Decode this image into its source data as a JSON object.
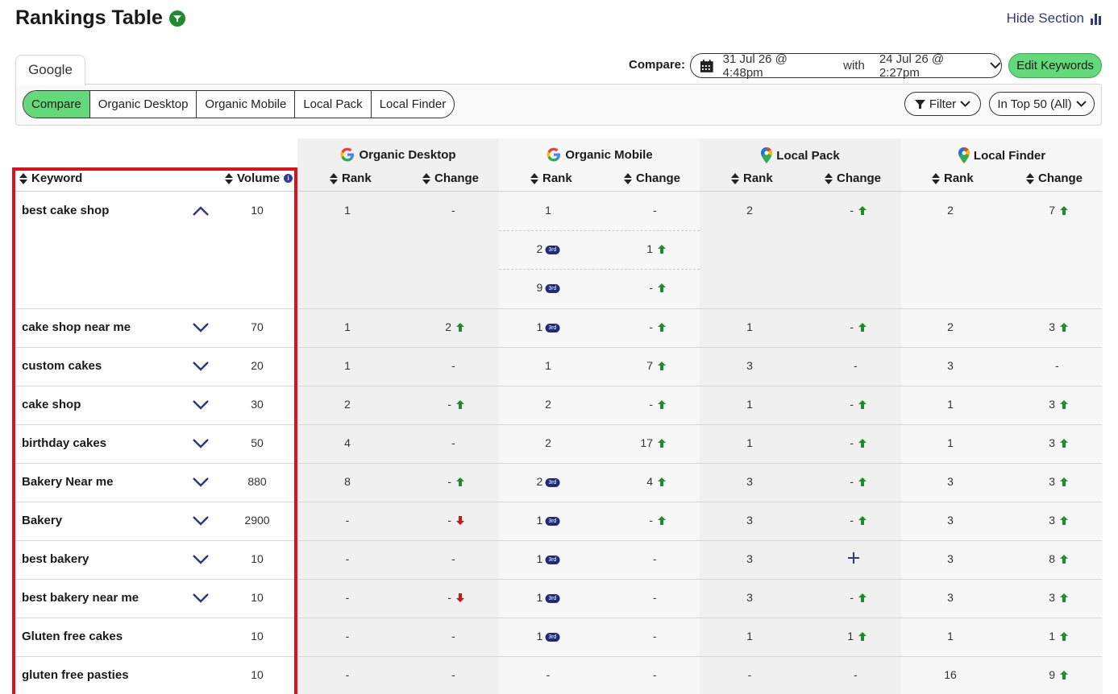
{
  "header": {
    "title": "Rankings Table",
    "hide_section": "Hide Section"
  },
  "tabs": {
    "active": "Google"
  },
  "segments": [
    "Compare",
    "Organic Desktop",
    "Organic Mobile",
    "Local Pack",
    "Local Finder"
  ],
  "compare": {
    "label": "Compare:",
    "date_from": "31 Jul 26 @ 4:48pm",
    "with": "with",
    "date_to": "24 Jul 26 @ 2:27pm",
    "edit_keywords": "Edit Keywords"
  },
  "filters": {
    "filter": "Filter",
    "top": "In Top 50 (All)"
  },
  "columns": {
    "keyword": "Keyword",
    "volume": "Volume",
    "groups": [
      "Organic Desktop",
      "Organic Mobile",
      "Local Pack",
      "Local Finder"
    ],
    "rank": "Rank",
    "change": "Change"
  },
  "colors": {
    "accent_green": "#63d97a",
    "up": "#1f8a2e",
    "down": "#c81818",
    "navy": "#1e2a7a",
    "highlight": "#e0101b"
  },
  "rows": [
    {
      "keyword": "best cake shop",
      "volume": "10",
      "expanded": true,
      "od": [
        "1",
        "-",
        ""
      ],
      "om": [
        [
          "1",
          "-",
          ""
        ],
        [
          "2",
          "1",
          "up",
          "3rd"
        ],
        [
          "9",
          "-",
          "up",
          "3rd"
        ]
      ],
      "lp": [
        "2",
        "-",
        "up"
      ],
      "lf": [
        "2",
        "7",
        "up"
      ]
    },
    {
      "keyword": "cake shop near me",
      "volume": "70",
      "od": [
        "1",
        "2",
        "up"
      ],
      "om": [
        "1",
        "-",
        "up",
        "3rd"
      ],
      "lp": [
        "1",
        "-",
        "up"
      ],
      "lf": [
        "2",
        "3",
        "up"
      ]
    },
    {
      "keyword": "custom cakes",
      "volume": "20",
      "od": [
        "1",
        "-",
        ""
      ],
      "om": [
        "1",
        "7",
        "up"
      ],
      "lp": [
        "3",
        "-",
        ""
      ],
      "lf": [
        "3",
        "-",
        ""
      ]
    },
    {
      "keyword": "cake shop",
      "volume": "30",
      "od": [
        "2",
        "-",
        "up"
      ],
      "om": [
        "2",
        "-",
        "up"
      ],
      "lp": [
        "1",
        "-",
        "up"
      ],
      "lf": [
        "1",
        "3",
        "up"
      ]
    },
    {
      "keyword": "birthday cakes",
      "volume": "50",
      "od": [
        "4",
        "-",
        ""
      ],
      "om": [
        "2",
        "17",
        "up"
      ],
      "lp": [
        "1",
        "-",
        "up"
      ],
      "lf": [
        "1",
        "3",
        "up"
      ]
    },
    {
      "keyword": "Bakery Near me",
      "volume": "880",
      "od": [
        "8",
        "-",
        "up"
      ],
      "om": [
        "2",
        "4",
        "up",
        "3rd"
      ],
      "lp": [
        "3",
        "-",
        "up"
      ],
      "lf": [
        "3",
        "3",
        "up"
      ]
    },
    {
      "keyword": "Bakery",
      "volume": "2900",
      "od": [
        "-",
        "-",
        "down"
      ],
      "om": [
        "1",
        "-",
        "up",
        "3rd"
      ],
      "lp": [
        "3",
        "-",
        "up"
      ],
      "lf": [
        "3",
        "3",
        "up"
      ]
    },
    {
      "keyword": "best bakery",
      "volume": "10",
      "od": [
        "-",
        "-",
        ""
      ],
      "om": [
        "1",
        "-",
        "",
        "3rd"
      ],
      "lp": [
        "3",
        "",
        "plus"
      ],
      "lf": [
        "3",
        "8",
        "up"
      ]
    },
    {
      "keyword": "best bakery near me",
      "volume": "10",
      "od": [
        "-",
        "-",
        "down"
      ],
      "om": [
        "1",
        "-",
        "",
        "3rd"
      ],
      "lp": [
        "3",
        "-",
        "up"
      ],
      "lf": [
        "3",
        "3",
        "up"
      ]
    },
    {
      "keyword": "Gluten free cakes",
      "volume": "10",
      "nochev": true,
      "od": [
        "-",
        "-",
        ""
      ],
      "om": [
        "1",
        "-",
        "",
        "3rd"
      ],
      "lp": [
        "1",
        "1",
        "up"
      ],
      "lf": [
        "1",
        "1",
        "up"
      ]
    },
    {
      "keyword": "gluten free pasties",
      "volume": "10",
      "nochev": true,
      "od": [
        "-",
        "-",
        ""
      ],
      "om": [
        "-",
        "-",
        ""
      ],
      "lp": [
        "-",
        "-",
        ""
      ],
      "lf": [
        "16",
        "9",
        "up"
      ]
    }
  ]
}
